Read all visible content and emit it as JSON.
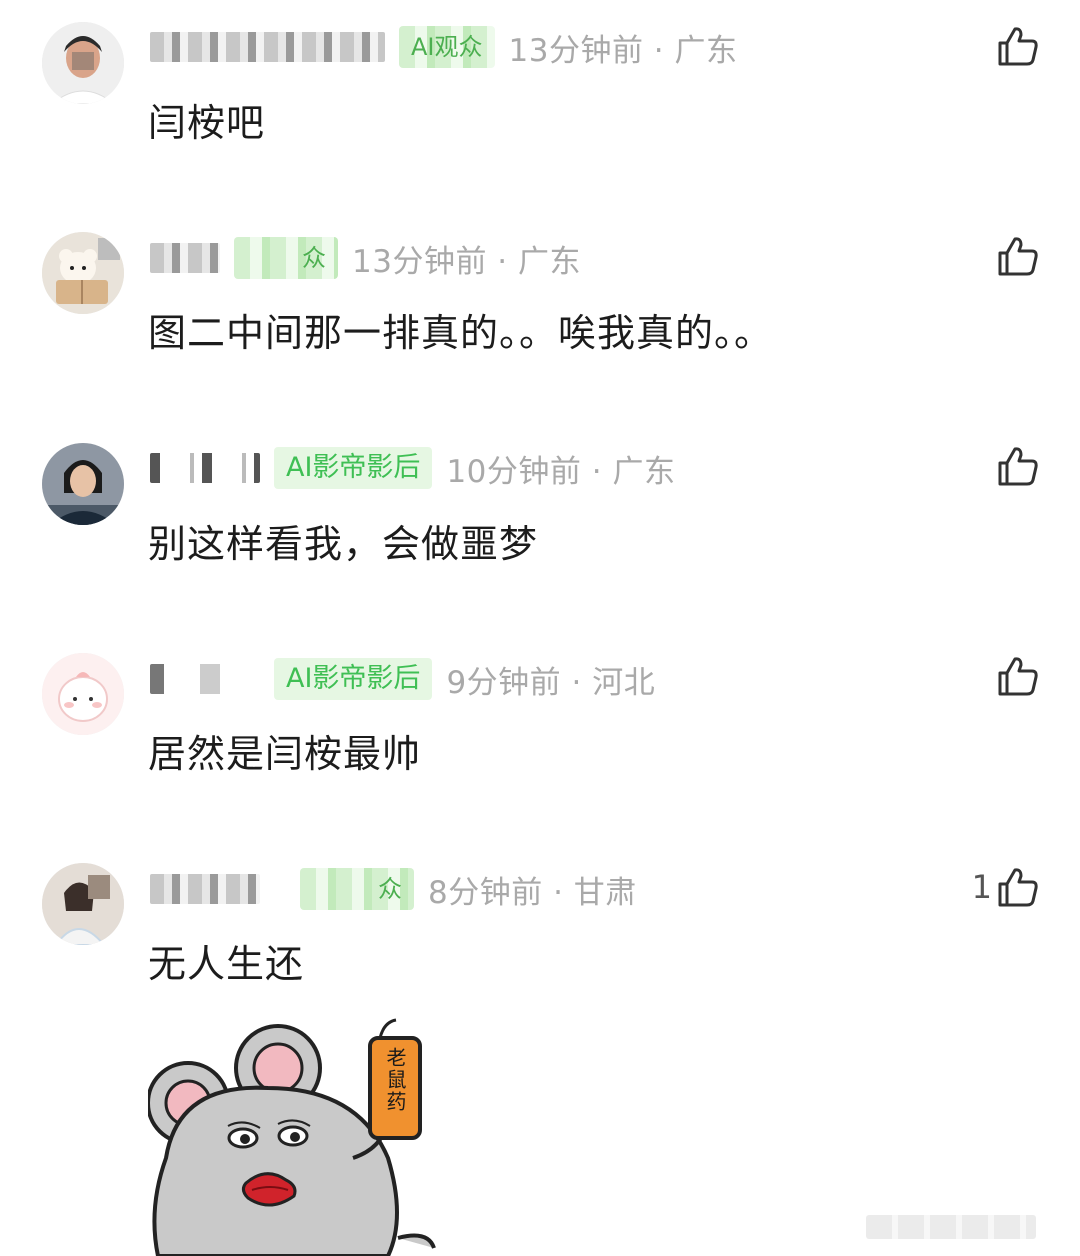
{
  "comments": [
    {
      "badge": "AI观众",
      "time": "13分钟前 · 广东",
      "text": "闫桉吧",
      "likes": ""
    },
    {
      "badge": "众",
      "time": "13分钟前 · 广东",
      "text": "图二中间那一排真的。。唉我真的。。",
      "likes": ""
    },
    {
      "badge": "AI影帝影后",
      "time": "10分钟前 · 广东",
      "text": "别这样看我，会做噩梦",
      "likes": ""
    },
    {
      "badge": "AI影帝影后",
      "time": "9分钟前 · 河北",
      "text": "居然是闫桉最帅",
      "likes": ""
    },
    {
      "badge": "众",
      "time": "8分钟前 · 甘肃",
      "text": "无人生还",
      "likes": "1",
      "sticker_label": "老鼠药"
    }
  ],
  "icons": {
    "like": "thumbs-up-icon"
  },
  "colors": {
    "badge_text": "#3fbf54",
    "badge_bg": "#e6f7e3",
    "meta_gray": "#a9a9a9"
  }
}
